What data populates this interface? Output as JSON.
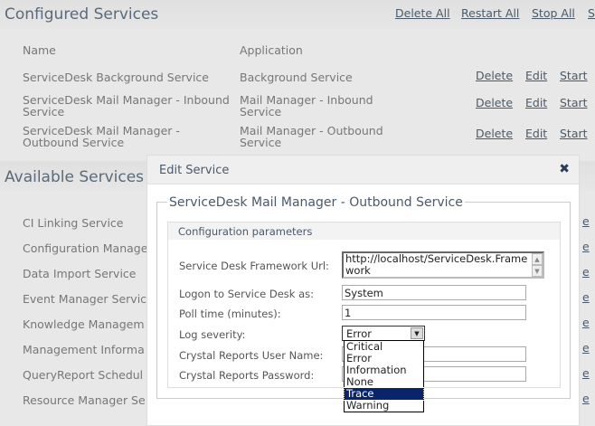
{
  "configured": {
    "title": "Configured Services",
    "actions": [
      "Delete All",
      "Restart All",
      "Stop All",
      "S"
    ],
    "headers": {
      "name": "Name",
      "application": "Application"
    },
    "rows": [
      {
        "name": [
          "ServiceDesk Background Service"
        ],
        "application": [
          "Background Service"
        ]
      },
      {
        "name": [
          "ServiceDesk Mail Manager - Inbound",
          "Service"
        ],
        "application": [
          "Mail Manager - Inbound",
          "Service"
        ]
      },
      {
        "name": [
          "ServiceDesk Mail Manager -",
          "Outbound Service"
        ],
        "application": [
          "Mail Manager - Outbound",
          "Service"
        ]
      }
    ],
    "row_actions": [
      "Delete",
      "Edit",
      "Start"
    ]
  },
  "available": {
    "title": "Available Services",
    "items": [
      "CI Linking Service",
      "Configuration Manage",
      "Data Import Service",
      "Event Manager Servic",
      "Knowledge Managem",
      "Management Informa",
      "QueryReport Schedul",
      "Resource Manager Se"
    ],
    "edge_link": "e"
  },
  "dialog": {
    "title": "Edit Service",
    "close_icon": "close-x-icon",
    "legend": "ServiceDesk Mail Manager - Outbound Service",
    "section": "Configuration parameters",
    "fields": {
      "url": {
        "label": "Service Desk Framework Url:",
        "value": "http://localhost/ServiceDesk.Framework"
      },
      "logon": {
        "label": "Logon to Service Desk as:",
        "value": "System"
      },
      "poll": {
        "label": "Poll time (minutes):",
        "value": "1"
      },
      "severity": {
        "label": "Log severity:",
        "value": "Error",
        "options": [
          "Critical",
          "Error",
          "Information",
          "None",
          "Trace",
          "Warning"
        ],
        "highlighted": "Trace"
      },
      "cr_user": {
        "label": "Crystal Reports User Name:",
        "value": ""
      },
      "cr_pass": {
        "label": "Crystal Reports Password:",
        "value": ""
      }
    }
  }
}
